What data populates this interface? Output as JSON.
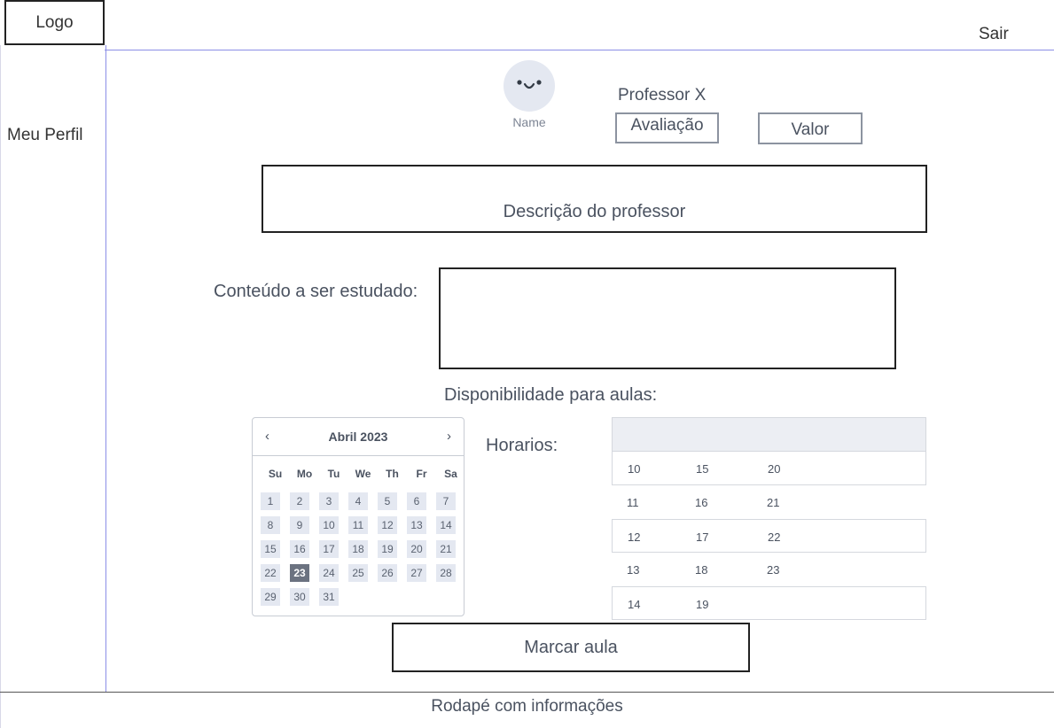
{
  "header": {
    "logo_text": "Logo",
    "logout_label": "Sair"
  },
  "sidebar": {
    "profile_label": "Meu Perfil"
  },
  "profile": {
    "avatar_caption": "Name",
    "teacher_name": "Professor X",
    "rating_label": "Avaliação",
    "price_label": "Valor",
    "description_text": "Descrição do professor"
  },
  "content": {
    "study_label": "Conteúdo a ser estudado:",
    "study_value": "",
    "availability_label": "Disponibilidade para aulas:"
  },
  "calendar": {
    "prev_icon": "chevron-left-icon",
    "next_icon": "chevron-right-icon",
    "prev_glyph": "‹",
    "next_glyph": "›",
    "title": "Abril 2023",
    "weekdays": [
      "Su",
      "Mo",
      "Tu",
      "We",
      "Th",
      "Fr",
      "Sa"
    ],
    "days": [
      "1",
      "2",
      "3",
      "4",
      "5",
      "6",
      "7",
      "8",
      "9",
      "10",
      "11",
      "12",
      "13",
      "14",
      "15",
      "16",
      "17",
      "18",
      "19",
      "20",
      "21",
      "22",
      "23",
      "24",
      "25",
      "26",
      "27",
      "28",
      "29",
      "30",
      "31"
    ],
    "selected_day": "23"
  },
  "schedule": {
    "label": "Horarios:",
    "rows": [
      [
        "10",
        "15",
        "20"
      ],
      [
        "11",
        "16",
        "21"
      ],
      [
        "12",
        "17",
        "22"
      ],
      [
        "13",
        "18",
        "23"
      ],
      [
        "14",
        "19",
        ""
      ]
    ]
  },
  "actions": {
    "book_label": "Marcar aula"
  },
  "footer": {
    "text": "Rodapé com informações"
  },
  "colors": {
    "divider": "#8b8ee6",
    "selected_day": "#6b7280",
    "day_bg": "#e4e8f1"
  }
}
